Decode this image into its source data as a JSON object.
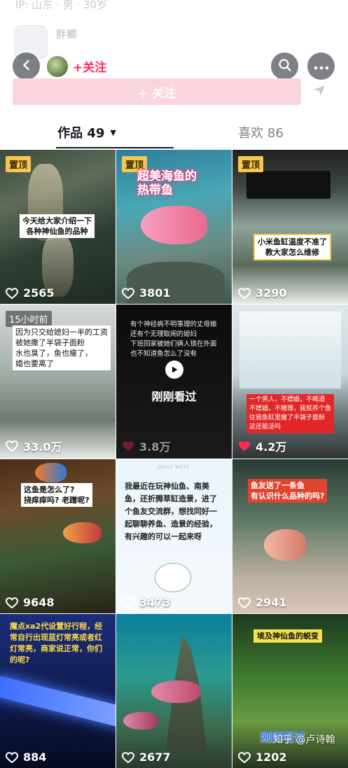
{
  "background_header": {
    "ghost_text": "IP: 山东 · 男 · 30岁",
    "ghost_name_1": "胖鲫",
    "ghost_name_2": "@胖鲫"
  },
  "topbar": {
    "follow_label": "+关注"
  },
  "follow_bar": {
    "label": "+ 关注"
  },
  "tabs": {
    "works_label": "作品 49",
    "likes_label": "喜欢 86"
  },
  "videos": [
    {
      "badge": "置顶",
      "caption": "今天给大家介绍一下\n各种神仙鱼的品种",
      "likes": "2565"
    },
    {
      "badge": "置顶",
      "caption": "超美海鱼的\n热带鱼",
      "likes": "3801"
    },
    {
      "badge": "置顶",
      "caption": "小米鱼缸温度不准了\n教大家怎么维修",
      "likes": "3290"
    },
    {
      "badge": "15小时前",
      "caption": "因为只交给媳妇一半的工资\n被她撒了半袋子面粉\n水也臭了，鱼也瘦了，\n婚也要离了",
      "likes": "33.0万"
    },
    {
      "badge": "",
      "caption": "有个神经病不明事理的丈母娘\n还有个无理取闹的媳妇\n下班回家被她们俩人锁在外面\n也不知道鱼怎么了没有",
      "overlay": "刚刚看过",
      "likes": "3.8万"
    },
    {
      "badge": "",
      "caption": "一个男人，不嫖娼，不喝酒\n不嫖娼，不赌博，我就养个鱼\n往我鱼缸里撒了半袋子面粉\n这还能活吗",
      "likes": "4.2万"
    },
    {
      "badge": "",
      "caption": "这鱼是怎么了?\n挠痒痒吗? 老蹭呢?",
      "likes": "9648"
    },
    {
      "badge": "",
      "note_header": "DAILY NOTE",
      "caption": "我最近在玩神仙鱼、南美鱼，还折腾草缸造景，进了个鱼友交流群，想找同好一起聊聊养鱼、造景的经验，有兴趣的可以一起来呀",
      "likes": "3473"
    },
    {
      "badge": "",
      "caption": "鱼友送了一条鱼\n有认识什么品种的吗?",
      "likes": "2941"
    },
    {
      "badge": "",
      "caption": "魔点xa2代设置好行程，经常自行出现蓝灯常亮或者红灯常亮，商家说正常，你们的呢?",
      "likes": "884"
    },
    {
      "badge": "",
      "caption": "",
      "likes": "2677"
    },
    {
      "badge": "",
      "caption": "埃及神仙鱼的蜕变",
      "overlay": "刚刚看过",
      "likes": "1202"
    }
  ],
  "watermark": "知乎 @卢诗翰",
  "colors": {
    "accent": "#fe2c55",
    "pin_badge": "#f6c64f",
    "follow_bar_bg": "#fbd5dd"
  }
}
